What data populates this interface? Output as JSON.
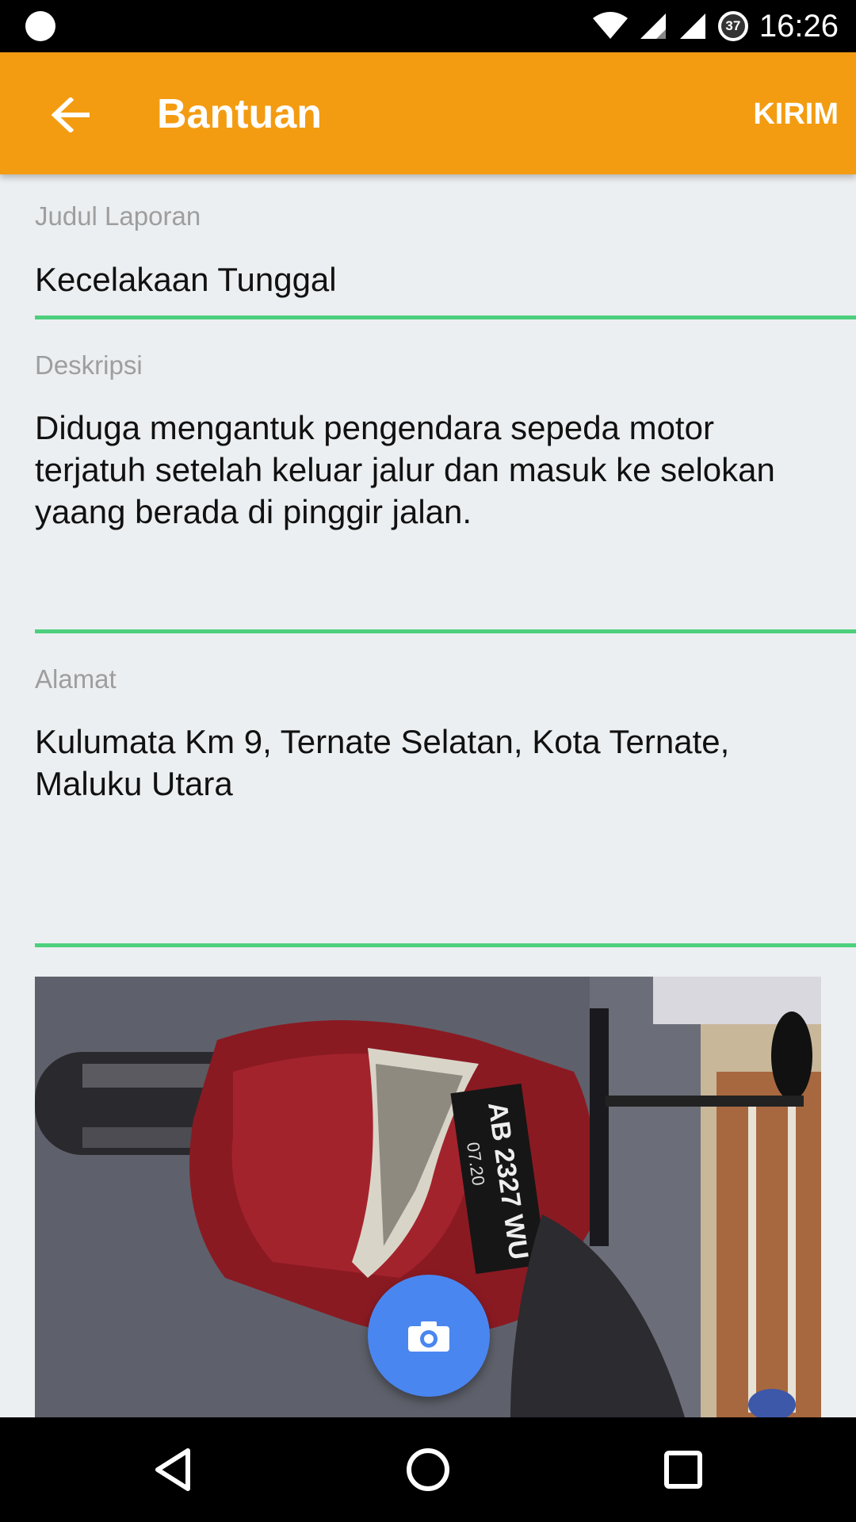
{
  "status_bar": {
    "time": "16:26",
    "battery_level": "37",
    "icons": [
      "notification-dot-icon",
      "wifi-icon",
      "signal-icon",
      "signal-icon",
      "battery-icon"
    ]
  },
  "app_bar": {
    "title": "Bantuan",
    "action_label": "KIRIM",
    "back_icon": "arrow-left-icon"
  },
  "form": {
    "title_field": {
      "label": "Judul Laporan",
      "value": "Kecelakaan Tunggal"
    },
    "description_field": {
      "label": "Deskripsi",
      "value": "Diduga mengantuk pengendara sepeda motor terjatuh setelah keluar jalur dan masuk ke selokan yaang berada di pinggir jalan."
    },
    "address_field": {
      "label": "Alamat",
      "value": "Kulumata Km 9, Ternate Selatan, Kota Ternate, Maluku Utara"
    },
    "accent_color": "#4cd07d"
  },
  "photo": {
    "plate_text": "AB 2327 WU",
    "plate_sub": "07.20"
  },
  "fab": {
    "icon": "camera-icon",
    "color": "#4a86f0"
  },
  "nav_bar": {
    "icons": [
      "back-triangle-icon",
      "home-circle-icon",
      "recents-square-icon"
    ]
  },
  "colors": {
    "app_bar": "#f39c12",
    "background": "#eceff1"
  }
}
